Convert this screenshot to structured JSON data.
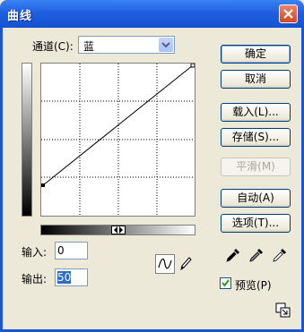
{
  "window": {
    "title": "曲线"
  },
  "channel": {
    "label": "通道(C):",
    "value": "蓝"
  },
  "fields": {
    "input_label": "输入:",
    "input_value": "0",
    "output_label": "输出:",
    "output_value": "50"
  },
  "buttons": {
    "ok": "确定",
    "cancel": "取消",
    "load": "载入(L)...",
    "save": "存储(S)...",
    "smooth": "平滑(M)",
    "auto": "自动(A)",
    "options": "选项(T)..."
  },
  "preview": {
    "label": "预览(P)",
    "checked": true
  },
  "icons": [
    "close-icon",
    "dropdown-arrow-icon",
    "curve-tool-icon",
    "pencil-tool-icon",
    "black-eyedropper-icon",
    "gray-eyedropper-icon",
    "white-eyedropper-icon",
    "expand-icon"
  ]
}
